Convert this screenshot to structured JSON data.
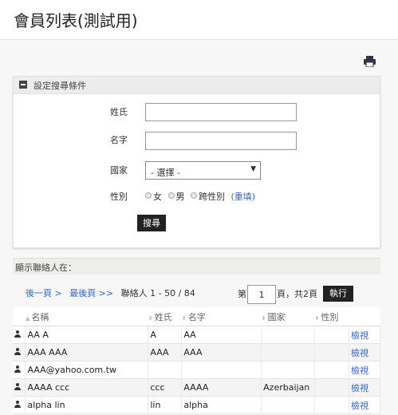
{
  "header": {
    "title": "會員列表(測試用)"
  },
  "icons": {
    "print": "print-icon",
    "collapse": "minus-square-icon",
    "person": "person-icon"
  },
  "search_panel": {
    "title": "設定搜尋條件",
    "last_name_label": "姓氏",
    "last_name_value": "",
    "first_name_label": "名字",
    "first_name_value": "",
    "country_label": "國家",
    "country_selected": "- 選擇 -",
    "gender_label": "性別",
    "gender_options": [
      "女",
      "男",
      "跨性別"
    ],
    "help_link": "(重填)",
    "search_button": "搜尋"
  },
  "results": {
    "show_label": "顯示聯絡人在：",
    "prev_link": "後一頁 >",
    "last_link": "最後頁 >>",
    "count_text": "聯絡人 1 - 50 / 84",
    "page_prefix": "第",
    "page_value": "1",
    "page_suffix": "頁，共2頁",
    "exec_button": "執行"
  },
  "table": {
    "columns": [
      "名稱",
      "姓氏",
      "名字",
      "國家",
      "性別"
    ],
    "view_label": "檢視",
    "rows": [
      {
        "name": "AA A",
        "last": "A",
        "first": "AA",
        "country": "",
        "gender": ""
      },
      {
        "name": "AAA AAA",
        "last": "AAA",
        "first": "AAA",
        "country": "",
        "gender": ""
      },
      {
        "name": "AAA@yahoo.com.tw",
        "last": "",
        "first": "",
        "country": "",
        "gender": ""
      },
      {
        "name": "AAAA ccc",
        "last": "ccc",
        "first": "AAAA",
        "country": "Azerbaijan",
        "gender": ""
      },
      {
        "name": "alpha lin",
        "last": "lin",
        "first": "alpha",
        "country": "",
        "gender": ""
      }
    ]
  },
  "colors": {
    "accent": "#3366cc",
    "button_bg": "#222222",
    "panel_head": "#ececec"
  }
}
